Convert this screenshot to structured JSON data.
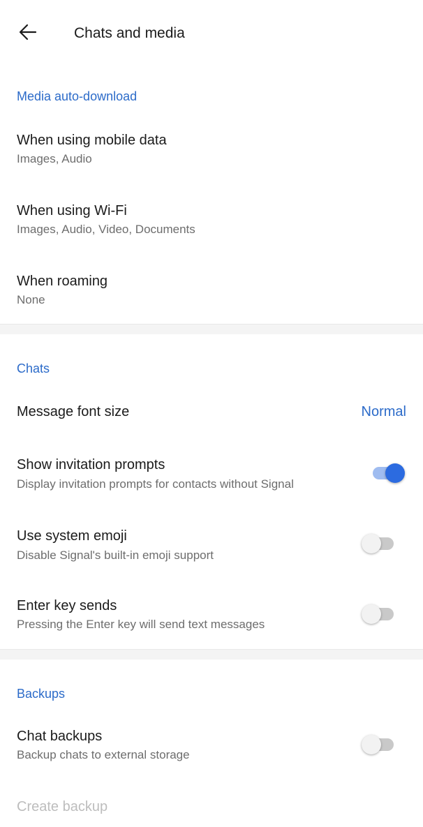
{
  "appbar": {
    "title": "Chats and media"
  },
  "media": {
    "header": "Media auto-download",
    "mobile": {
      "title": "When using mobile data",
      "subtitle": "Images, Audio"
    },
    "wifi": {
      "title": "When using Wi-Fi",
      "subtitle": "Images, Audio, Video, Documents"
    },
    "roaming": {
      "title": "When roaming",
      "subtitle": "None"
    }
  },
  "chats": {
    "header": "Chats",
    "font_size": {
      "title": "Message font size",
      "value": "Normal"
    },
    "invitation": {
      "title": "Show invitation prompts",
      "subtitle": "Display invitation prompts for contacts without Signal",
      "enabled": true
    },
    "system_emoji": {
      "title": "Use system emoji",
      "subtitle": "Disable Signal's built-in emoji support",
      "enabled": false
    },
    "enter_sends": {
      "title": "Enter key sends",
      "subtitle": "Pressing the Enter key will send text messages",
      "enabled": false
    }
  },
  "backups": {
    "header": "Backups",
    "chat_backups": {
      "title": "Chat backups",
      "subtitle": "Backup chats to external storage",
      "enabled": false
    },
    "create_backup": {
      "title": "Create backup"
    }
  },
  "colors": {
    "accent": "#2c6bc9",
    "switch_on": "#2c6be0"
  }
}
